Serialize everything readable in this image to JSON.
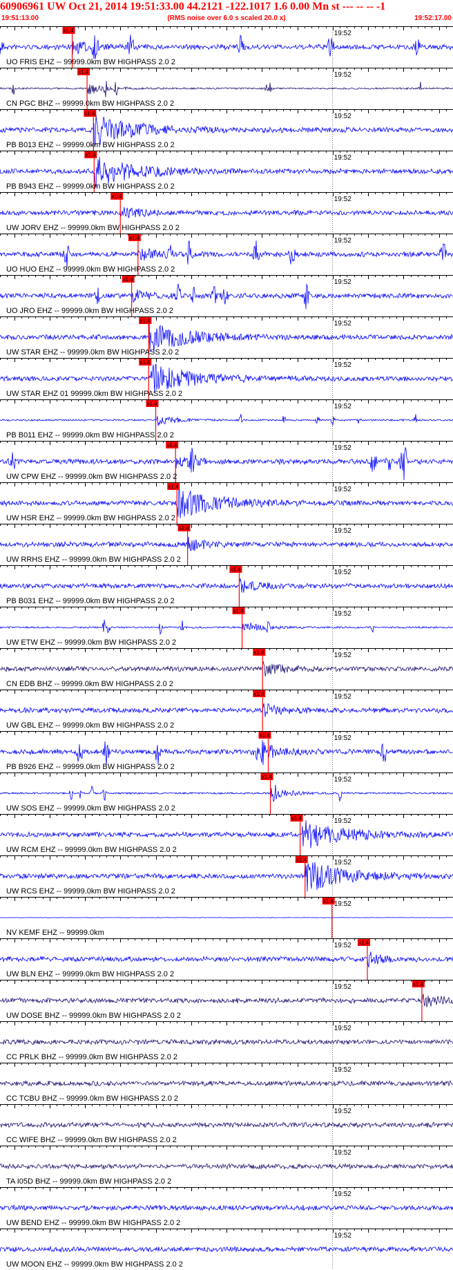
{
  "header": {
    "title": "60906961 UW Oct 21, 2014 19:51:33.00   44.2121 -122.1017  1.6 0.00 Mn st --- -- --   -1",
    "start_time": "19:51:13.00",
    "noise_note": "(RMS noise over 6.0 s scaled 20.0 x)",
    "end_time": "19:52:17.00"
  },
  "colors": {
    "trace": "#0000ff",
    "trace_dark": "#1a1070",
    "pick": "#ff0000",
    "axis": "#000000",
    "title": "#ff0000"
  },
  "chart_data": {
    "type": "line",
    "time_start": "19:51:13.00",
    "time_end": "19:52:17.00",
    "minute_marker": "19:52",
    "pick_label": "x1.4",
    "traces": [
      {
        "label": "UO FRIS EHZ -- 99999.0km BW  HIGHPASS  2.0  2",
        "pick_time": "19:51:23.2",
        "style": "bursts",
        "color": "blue"
      },
      {
        "label": "CN PGC BHZ -- 99999.0km BW  HIGHPASS  2.0  2",
        "pick_time": "19:51:25.3",
        "style": "spikes",
        "color": "dark"
      },
      {
        "label": "PB B013 EHZ -- 99999.0km BW  HIGHPASS  2.0  2",
        "pick_time": "19:51:26.2",
        "style": "event",
        "color": "blue"
      },
      {
        "label": "PB B943 EHZ -- 99999.0km BW  HIGHPASS  2.0  2",
        "pick_time": "19:51:26.3",
        "style": "event",
        "color": "blue"
      },
      {
        "label": "UW JORV EHZ -- 99999.0km BW  HIGHPASS  2.0  2",
        "pick_time": "19:51:30.0",
        "style": "noise",
        "color": "blue"
      },
      {
        "label": "UO HUO EHZ -- 99999.0km BW  HIGHPASS  2.0  2",
        "pick_time": "19:51:32.5",
        "style": "bursts",
        "color": "blue"
      },
      {
        "label": "UO JRO EHZ -- 99999.0km BW  HIGHPASS  2.0  2",
        "pick_time": "19:51:31.6",
        "style": "bursts",
        "color": "blue"
      },
      {
        "label": "UW STAR EHZ -- 99999.0km BW  HIGHPASS  2.0  2",
        "pick_time": "19:51:34.0",
        "style": "event",
        "color": "blue"
      },
      {
        "label": "UW STAR EHZ 01 99999.0km BW  HIGHPASS  2.0  2",
        "pick_time": "19:51:34.0",
        "style": "event",
        "color": "blue"
      },
      {
        "label": "PB B011 EHZ -- 99999.0km BW  HIGHPASS  2.0  2",
        "pick_time": "19:51:35.0",
        "style": "spikes",
        "color": "blue"
      },
      {
        "label": "UW CPW EHZ -- 99999.0km BW  HIGHPASS  2.0  2",
        "pick_time": "19:51:37.8",
        "style": "bursts",
        "color": "blue"
      },
      {
        "label": "UW HSR EHZ -- 99999.0km BW  HIGHPASS  2.0  2",
        "pick_time": "19:51:38.0",
        "style": "event",
        "color": "blue"
      },
      {
        "label": "UW RRHS EHZ -- 99999.0km BW  HIGHPASS  2.0  2",
        "pick_time": "19:51:39.5",
        "style": "noise",
        "color": "blue"
      },
      {
        "label": "PB B031 EHZ -- 99999.0km BW  HIGHPASS  2.0  2",
        "pick_time": "19:51:46.8",
        "style": "noise",
        "color": "blue"
      },
      {
        "label": "UW ETW EHZ -- 99999.0km BW  HIGHPASS  2.0  2",
        "pick_time": "19:51:47.2",
        "style": "spikes",
        "color": "blue"
      },
      {
        "label": "CN EDB BHZ -- 99999.0km BW  HIGHPASS  2.0  2",
        "pick_time": "19:51:50.1",
        "style": "noise",
        "color": "dark"
      },
      {
        "label": "UW GBL EHZ -- 99999.0km BW  HIGHPASS  2.0  2",
        "pick_time": "19:51:50.1",
        "style": "noise",
        "color": "blue"
      },
      {
        "label": "PB B926 EHZ -- 99999.0km BW  HIGHPASS  2.0  2",
        "pick_time": "19:51:50.9",
        "style": "bursts",
        "color": "blue"
      },
      {
        "label": "UW SOS EHZ -- 99999.0km BW  HIGHPASS  2.0  2",
        "pick_time": "19:51:51.2",
        "style": "spikes",
        "color": "blue"
      },
      {
        "label": "UW RCM EHZ -- 99999.0km BW  HIGHPASS  2.0  2",
        "pick_time": "19:51:55.4",
        "style": "event",
        "color": "blue"
      },
      {
        "label": "UW RCS EHZ -- 99999.0km BW  HIGHPASS  2.0  2",
        "pick_time": "19:51:56.1",
        "style": "event",
        "color": "blue"
      },
      {
        "label": "NV KEMF EHZ -- 99999.0km",
        "pick_time": "19:51:59.9",
        "style": "flat",
        "color": "blue"
      },
      {
        "label": "UW BLN EHZ -- 99999.0km BW  HIGHPASS  2.0  2",
        "pick_time": "19:52:04.9",
        "style": "noise",
        "color": "blue"
      },
      {
        "label": "UW DOSE BHZ -- 99999.0km BW  HIGHPASS  2.0  2",
        "pick_time": "19:52:12.6",
        "style": "noise",
        "color": "dark"
      },
      {
        "label": "CC PRLK BHZ -- 99999.0km BW  HIGHPASS  2.0  2",
        "pick_time": null,
        "style": "noise",
        "color": "dark"
      },
      {
        "label": "CC TCBU BHZ -- 99999.0km BW  HIGHPASS  2.0  2",
        "pick_time": null,
        "style": "noise",
        "color": "dark"
      },
      {
        "label": "CC WIFE BHZ -- 99999.0km BW  HIGHPASS  2.0  2",
        "pick_time": null,
        "style": "noise",
        "color": "dark"
      },
      {
        "label": "TA I05D BHZ -- 99999.0km BW  HIGHPASS  2.0  2",
        "pick_time": null,
        "style": "noise",
        "color": "dark"
      },
      {
        "label": "UW BEND EHZ -- 99999.0km BW  HIGHPASS  2.0  2",
        "pick_time": null,
        "style": "noise",
        "color": "blue"
      },
      {
        "label": "UW MOON EHZ -- 99999.0km BW  HIGHPASS  2.0  2",
        "pick_time": null,
        "style": "noise",
        "color": "blue"
      }
    ]
  }
}
